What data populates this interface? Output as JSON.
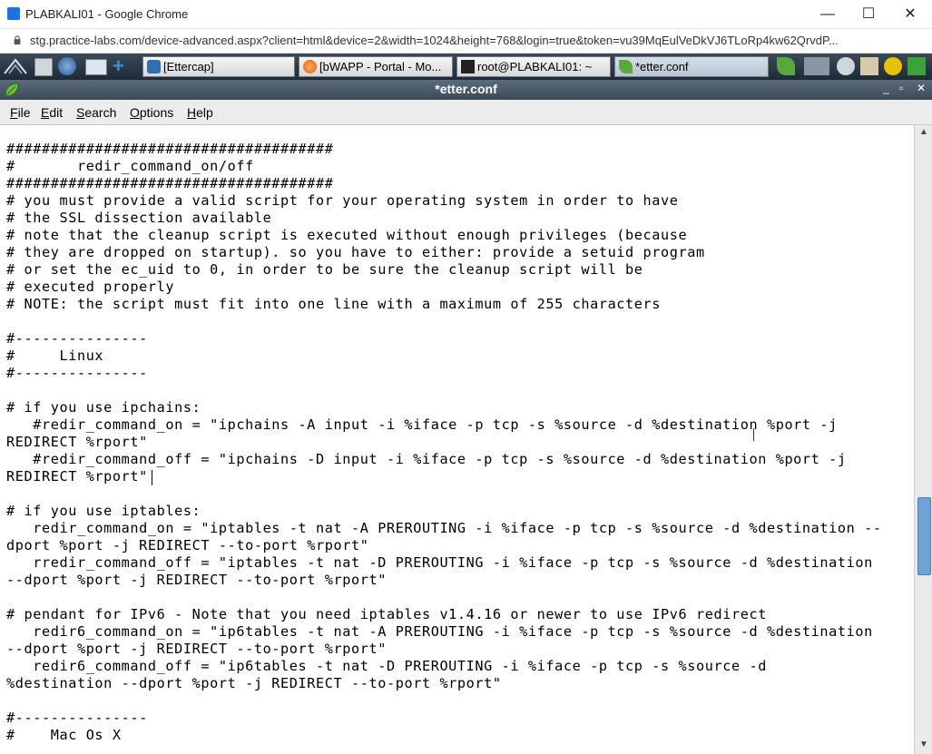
{
  "chrome": {
    "title": "PLABKALI01 - Google Chrome",
    "minimize": "—",
    "maximize": "☐",
    "close": "✕",
    "url": "stg.practice-labs.com/device-advanced.aspx?client=html&device=2&width=1024&height=768&login=true&token=vu39MqEulVeDkVJ6TLoRp4kw62QrvdP..."
  },
  "taskbar": {
    "tasks": [
      {
        "label": "[Ettercap]"
      },
      {
        "label": "[bWAPP - Portal - Mo..."
      },
      {
        "label": "root@PLABKALI01: ~"
      },
      {
        "label": "*etter.conf"
      }
    ]
  },
  "editor": {
    "title": "*etter.conf",
    "min": "_",
    "max": "▫",
    "close": "✕",
    "menu": [
      {
        "u": "F",
        "rest": "ile"
      },
      {
        "u": "E",
        "rest": "dit"
      },
      {
        "u": "S",
        "rest": "earch"
      },
      {
        "u": "O",
        "rest": "ptions"
      },
      {
        "u": "H",
        "rest": "elp"
      }
    ],
    "content": "#####################################\n#       redir_command_on/off\n#####################################\n# you must provide a valid script for your operating system in order to have\n# the SSL dissection available\n# note that the cleanup script is executed without enough privileges (because\n# they are dropped on startup). so you have to either: provide a setuid program\n# or set the ec_uid to 0, in order to be sure the cleanup script will be\n# executed properly\n# NOTE: the script must fit into one line with a maximum of 255 characters\n\n#---------------\n#     Linux\n#---------------\n\n# if you use ipchains:\n   #redir_command_on = \"ipchains -A input -i %iface -p tcp -s %source -d %destination %port -j\nREDIRECT %rport\"\n   #redir_command_off = \"ipchains -D input -i %iface -p tcp -s %source -d %destination %port -j\nREDIRECT %rport\"\n\n# if you use iptables:\n   redir_command_on = \"iptables -t nat -A PREROUTING -i %iface -p tcp -s %source -d %destination --\ndport %port -j REDIRECT --to-port %rport\"\n   rredir_command_off = \"iptables -t nat -D PREROUTING -i %iface -p tcp -s %source -d %destination\n--dport %port -j REDIRECT --to-port %rport\"\n\n# pendant for IPv6 - Note that you need iptables v1.4.16 or newer to use IPv6 redirect\n   redir6_command_on = \"ip6tables -t nat -A PREROUTING -i %iface -p tcp -s %source -d %destination\n--dport %port -j REDIRECT --to-port %rport\"\n   redir6_command_off = \"ip6tables -t nat -D PREROUTING -i %iface -p tcp -s %source -d\n%destination --dport %port -j REDIRECT --to-port %rport\"\n\n#---------------\n#    Mac Os X"
  },
  "scrollbar": {
    "up": "▲",
    "down": "▼"
  }
}
